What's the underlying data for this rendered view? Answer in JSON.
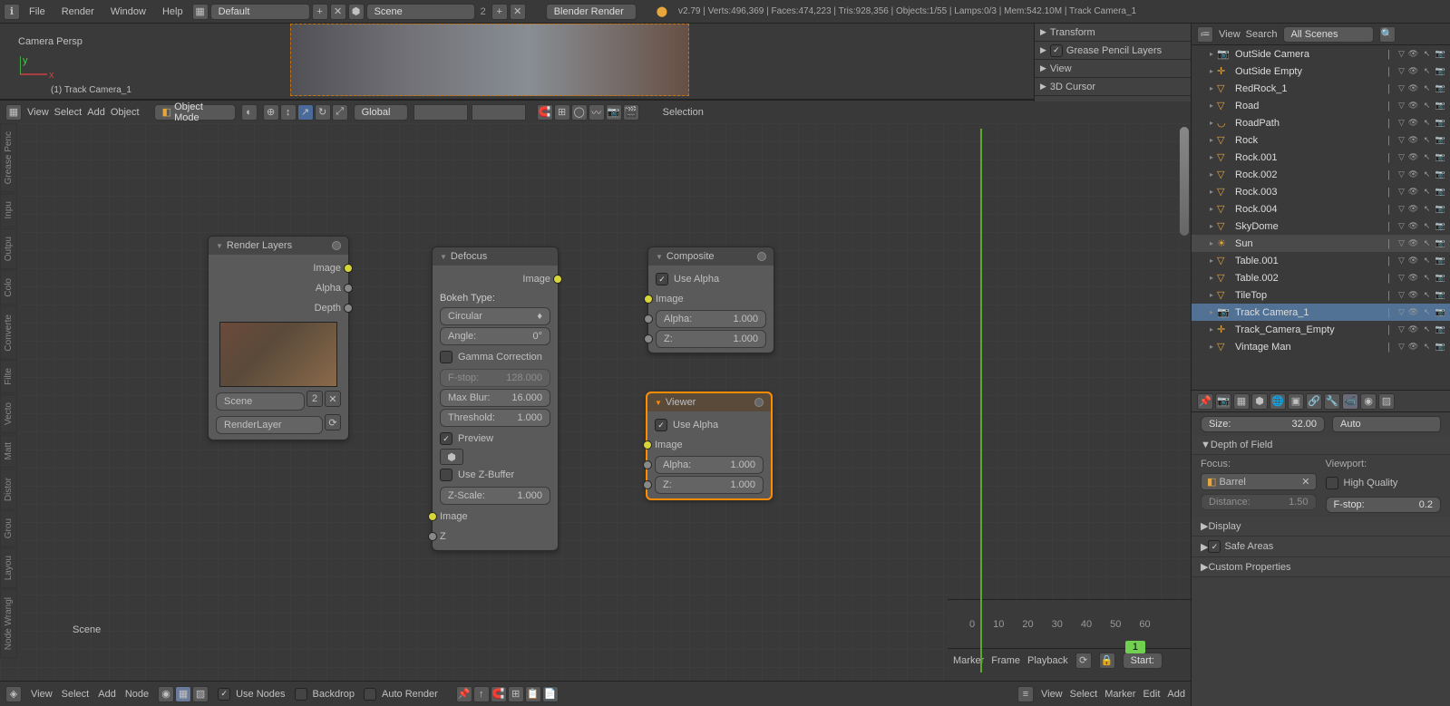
{
  "topbar": {
    "menus": [
      "File",
      "Render",
      "Window",
      "Help"
    ],
    "layout": "Default",
    "scene": "Scene",
    "scene_count": "2",
    "engine": "Blender Render",
    "stats": "v2.79 | Verts:496,369 | Faces:474,223 | Tris:928,356 | Objects:1/55 | Lamps:0/3 | Mem:542.10M | Track Camera_1"
  },
  "viewport": {
    "label": "Camera Persp",
    "sublabel": "(1) Track Camera_1",
    "header_menus": [
      "View",
      "Select",
      "Add",
      "Object"
    ],
    "mode": "Object Mode",
    "orientation": "Global",
    "overlay_text": "Selection"
  },
  "transform_panels": [
    "Transform",
    "Grease Pencil Layers",
    "View",
    "3D Cursor"
  ],
  "outliner": {
    "header_menus": [
      "View",
      "Search"
    ],
    "filter": "All Scenes",
    "items": [
      {
        "name": "OutSide Camera",
        "icon": "📷",
        "color": "#e8a63a"
      },
      {
        "name": "OutSide Empty",
        "icon": "✛",
        "color": "#e8a63a"
      },
      {
        "name": "RedRock_1",
        "icon": "▽",
        "color": "#e8a63a"
      },
      {
        "name": "Road",
        "icon": "▽",
        "color": "#e8a63a"
      },
      {
        "name": "RoadPath",
        "icon": "◡",
        "color": "#e8a63a"
      },
      {
        "name": "Rock",
        "icon": "▽",
        "color": "#e8a63a"
      },
      {
        "name": "Rock.001",
        "icon": "▽",
        "color": "#e8a63a"
      },
      {
        "name": "Rock.002",
        "icon": "▽",
        "color": "#e8a63a"
      },
      {
        "name": "Rock.003",
        "icon": "▽",
        "color": "#e8a63a"
      },
      {
        "name": "Rock.004",
        "icon": "▽",
        "color": "#e8a63a"
      },
      {
        "name": "SkyDome",
        "icon": "▽",
        "color": "#e8a63a"
      },
      {
        "name": "Sun",
        "icon": "☀",
        "color": "#e8a63a",
        "highlight": true
      },
      {
        "name": "Table.001",
        "icon": "▽",
        "color": "#e8a63a"
      },
      {
        "name": "Table.002",
        "icon": "▽",
        "color": "#e8a63a"
      },
      {
        "name": "TileTop",
        "icon": "▽",
        "color": "#e8a63a"
      },
      {
        "name": "Track Camera_1",
        "icon": "📷",
        "color": "#e8a63a",
        "selected": true
      },
      {
        "name": "Track_Camera_Empty",
        "icon": "✛",
        "color": "#e8a63a"
      },
      {
        "name": "Vintage Man",
        "icon": "▽",
        "color": "#e8a63a"
      }
    ]
  },
  "props": {
    "size": {
      "label": "Size:",
      "value": "32.00"
    },
    "auto": "Auto",
    "dof_title": "Depth of Field",
    "focus_label": "Focus:",
    "focus_value": "Barrel",
    "distance": {
      "label": "Distance:",
      "value": "1.50"
    },
    "viewport_label": "Viewport:",
    "high_quality": "High Quality",
    "fstop": {
      "label": "F-stop:",
      "value": "0.2"
    },
    "sections": [
      "Display",
      "Safe Areas",
      "Custom Properties"
    ]
  },
  "nodes": {
    "render_layers": {
      "title": "Render Layers",
      "outputs": [
        "Image",
        "Alpha",
        "Depth"
      ],
      "scene": "Scene",
      "scene_num": "2",
      "layer": "RenderLayer"
    },
    "defocus": {
      "title": "Defocus",
      "output": "Image",
      "bokeh_label": "Bokeh Type:",
      "bokeh": "Circular",
      "angle": {
        "label": "Angle:",
        "value": "0°"
      },
      "gamma": "Gamma Correction",
      "fstop": {
        "label": "F-stop:",
        "value": "128.000"
      },
      "maxblur": {
        "label": "Max Blur:",
        "value": "16.000"
      },
      "threshold": {
        "label": "Threshold:",
        "value": "1.000"
      },
      "preview": "Preview",
      "zbuffer": "Use Z-Buffer",
      "zscale": {
        "label": "Z-Scale:",
        "value": "1.000"
      },
      "inputs": [
        "Image",
        "Z"
      ]
    },
    "composite": {
      "title": "Composite",
      "use_alpha": "Use Alpha",
      "image": "Image",
      "alpha": {
        "label": "Alpha:",
        "value": "1.000"
      },
      "z": {
        "label": "Z:",
        "value": "1.000"
      }
    },
    "viewer": {
      "title": "Viewer",
      "use_alpha": "Use Alpha",
      "image": "Image",
      "alpha": {
        "label": "Alpha:",
        "value": "1.000"
      },
      "z": {
        "label": "Z:",
        "value": "1.000"
      }
    }
  },
  "node_footer": {
    "menus": [
      "View",
      "Select",
      "Add",
      "Node"
    ],
    "use_nodes": "Use Nodes",
    "backdrop": "Backdrop",
    "auto_render": "Auto Render"
  },
  "timeline": {
    "ticks": [
      "0",
      "10",
      "20",
      "30",
      "40",
      "50",
      "60"
    ],
    "menus": [
      "Marker",
      "Frame",
      "Playback"
    ],
    "start": "Start:",
    "bottom_menus": [
      "View",
      "Select",
      "Marker",
      "Edit",
      "Add"
    ],
    "frame": "1"
  },
  "vert_tabs": [
    "Grease Penc",
    "Inpu",
    "Outpu",
    "Colo",
    "Converte",
    "Filte",
    "Vecto",
    "Matt",
    "Distor",
    "Grou",
    "Layou",
    "Node Wrangl"
  ],
  "scene_label": "Scene"
}
